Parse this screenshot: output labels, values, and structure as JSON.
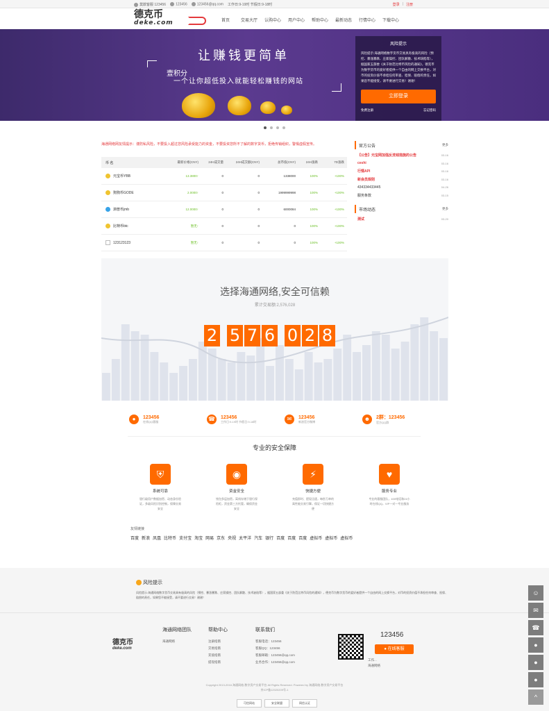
{
  "topbar": {
    "qq_label": "莫欺客服",
    "qq": "123456",
    "phone": "123456",
    "email": "123456@qq.com",
    "hours": "工作日:9-19时 节假日:9-18时",
    "login": "登录",
    "register": "注册"
  },
  "logo": {
    "cn": "德克币",
    "en": "deke.com"
  },
  "nav": [
    "首页",
    "交易大厅",
    "认购中心",
    "用户中心",
    "帮助中心",
    "最新动态",
    "行情中心",
    "下载中心"
  ],
  "banner": {
    "title": "让赚钱更简单",
    "line1": "壹积分",
    "line2": "一个让你超低投入就能轻松赚钱的网站"
  },
  "risk_box": {
    "title": "风险提示",
    "text": "风险提示:海通网络数字货币交易具有极高的风险（预挖、暴涨暴跌、庄家操控、团队解散、技术缺陷等），据国家五部委《关于防范比特币风险的通知》，德克币为数字货币的爱好者提供一个自由的网上交换平台，对币的投资价值不承担任何审查、担保、赔偿的责任，如果您不能接受，请不要进行交易！谢谢！",
    "button": "立即登录",
    "link_left": "免费注册",
    "link_right": "忘记密码"
  },
  "market": {
    "warning": "海通网络网友情提示：谨防私风险，不要投入超过您风险承受能力的资金，不要投资您所不了解的数字货币，拒绝传销组织，警惕虚假宣传。",
    "headers": [
      "币 名",
      "最新价格(CNY)",
      "24H成交量",
      "24H成交额(CNY)",
      "总市值(CNY)",
      "24H涨跌",
      "7D涨跌"
    ],
    "rows": [
      {
        "name": "元宝币YBB",
        "price": "13.3800↑",
        "vol": "0",
        "amount": "0",
        "cap": "1338000",
        "d24": "100%",
        "d7": "+100%",
        "icon": "coin-gold"
      },
      {
        "name": "狗狗币GODE",
        "price": "2.0000↑",
        "vol": "0",
        "amount": "0",
        "cap": "1999999998",
        "d24": "100%",
        "d7": "+100%",
        "icon": "coin-gold"
      },
      {
        "name": "泗普币jmb",
        "price": "12.0000↑",
        "vol": "0",
        "amount": "0",
        "cap": "6000084",
        "d24": "100%",
        "d7": "+100%",
        "icon": "coin-blue"
      },
      {
        "name": "比特币btc",
        "price": "暂无↑",
        "vol": "0",
        "amount": "0",
        "cap": "0",
        "d24": "100%",
        "d7": "+100%",
        "icon": "coin-gold"
      },
      {
        "name": "123123123",
        "price": "暂无↑",
        "vol": "0",
        "amount": "0",
        "cap": "0",
        "d24": "100%",
        "d7": "+100%",
        "icon": "broken-image"
      }
    ]
  },
  "notices": {
    "title": "官方公告",
    "more": "更多",
    "items": [
      {
        "text": "【公告】元宝网加强反洗钱措施的公告",
        "date": "03-16",
        "style": "red"
      },
      {
        "text": "ceshi",
        "date": "03-16",
        "style": "red"
      },
      {
        "text": "行情API",
        "date": "03-16",
        "style": "red"
      },
      {
        "text": "新会员规则",
        "date": "03-16",
        "style": "red"
      },
      {
        "text": "434334433445",
        "date": "04-26",
        "style": "normal"
      },
      {
        "text": "服务条款",
        "date": "03-15",
        "style": "normal"
      }
    ]
  },
  "market_news": {
    "title": "市场动态",
    "more": "更多",
    "items": [
      {
        "text": "测试",
        "date": "03-20",
        "style": "red"
      }
    ]
  },
  "stats": {
    "title": "选择海通网络,安全可信赖",
    "subtitle": "累计交易额:2,576,028",
    "digits": [
      "2",
      "5",
      "7",
      "6",
      "0",
      "2",
      "8"
    ]
  },
  "contacts": [
    {
      "icon": "qq-icon",
      "value": "123456",
      "label": "在线QQ客服"
    },
    {
      "icon": "phone-icon",
      "value": "123456",
      "label": "工作日:9-19时 节假日:9-18时"
    },
    {
      "icon": "email-icon",
      "value": "123456",
      "label": "新浪官方微博"
    },
    {
      "icon": "group-icon",
      "value": "2群：123456",
      "label": "官方QQ群"
    }
  ],
  "security": {
    "title": "专业的安全保障",
    "features": [
      {
        "icon": "shield-icon",
        "name": "系统可靠",
        "desc": "银行级用户数据加密、动态身份验证，多级风险识别控制，保障交易安全"
      },
      {
        "icon": "lock-icon",
        "name": "资金安全",
        "desc": "钱包多层加密，离线存储于银行保险柜，资金第三方托管，确保资金安全"
      },
      {
        "icon": "lightning-icon",
        "name": "快捷方便",
        "desc": "充值即时、提现迅速，每秒万单的高性能交易引擎，保证一切快捷方便"
      },
      {
        "icon": "heart-icon",
        "name": "服务专业",
        "desc": "专业的客服团队，400电话和24小时在线QQ，VIP一对一专业服务"
      }
    ]
  },
  "friend_links": {
    "title": "友情链接",
    "items": [
      "百度",
      "新浪",
      "凤凰",
      "比特币",
      "支付宝",
      "淘宝",
      "网易",
      "京东",
      "央视",
      "太平洋",
      "汽车",
      "银行",
      "百度",
      "百度",
      "百度",
      "虚拟币",
      "虚拟币",
      "虚拟币"
    ]
  },
  "risk_footer": {
    "title": "风险提示",
    "text": "风险提示:海通网络数字货币交易具有极高的风险（预挖、暴涨暴跌、庄家操控、团队解散、技术缺陷等），据国家五部委《关于防范比特币风险的通知》，德克币为数字货币的爱好者提供一个自由的网上交换平台，对币的投资价值不承担任何审查、担保、赔偿的责任，如果您不能接受，请不要进行交易！谢谢！"
  },
  "footer": {
    "team": {
      "title": "海通网络团队",
      "items": [
        "海通网络"
      ]
    },
    "help": {
      "title": "帮助中心",
      "items": [
        "注册指南",
        "交易指南",
        "充值指南",
        "提现指南"
      ]
    },
    "contact": {
      "title": "联系我们",
      "items": [
        "客服电话：123456",
        "客服QQ：123456",
        "客服邮箱：123456@qq.com",
        "业务合作：123456@qq.com"
      ]
    },
    "phone": "123456",
    "online_btn": "在线客服",
    "small1": "工作...",
    "small2": "海通网络",
    "copyright": "Copyright 2013-2016 海通网络-数字资产交易平台 All Rights Reserved. Powered by 海通网络-数字资产交易平台",
    "icp": "京ICP备12020209号-1",
    "badges": [
      "可信网站",
      "安全联盟",
      "网信认证"
    ]
  },
  "float_bar": [
    "chat-icon",
    "wechat-icon",
    "phone-icon",
    "qq-icon",
    "qq-icon",
    "qq-icon",
    "arrow-up-icon"
  ]
}
